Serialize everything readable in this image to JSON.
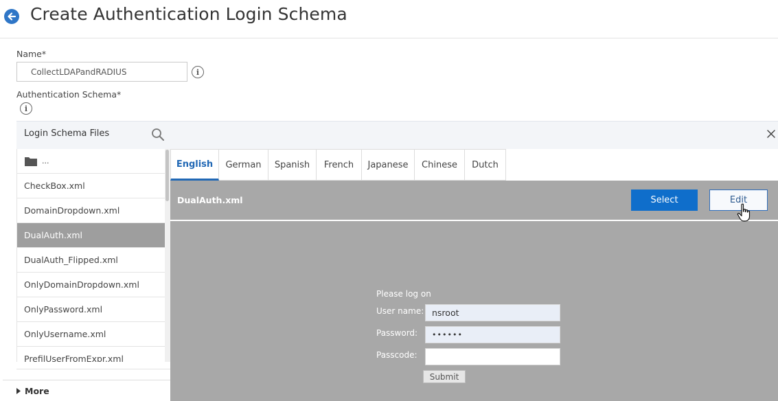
{
  "header": {
    "title": "Create Authentication Login Schema"
  },
  "form": {
    "name_label": "Name*",
    "name_value": "CollectLDAPandRADIUS",
    "schema_label": "Authentication Schema*"
  },
  "panel": {
    "title": "Login Schema Files",
    "files": [
      {
        "label": "..."
      },
      {
        "label": "CheckBox.xml"
      },
      {
        "label": "DomainDropdown.xml"
      },
      {
        "label": "DualAuth.xml"
      },
      {
        "label": "DualAuth_Flipped.xml"
      },
      {
        "label": "OnlyDomainDropdown.xml"
      },
      {
        "label": "OnlyPassword.xml"
      },
      {
        "label": "OnlyUsername.xml"
      },
      {
        "label": "PrefilUserFromExpr.xml"
      }
    ],
    "selected_file": "DualAuth.xml",
    "more_label": "More"
  },
  "tabs": [
    {
      "label": "English"
    },
    {
      "label": "German"
    },
    {
      "label": "Spanish"
    },
    {
      "label": "French"
    },
    {
      "label": "Japanese"
    },
    {
      "label": "Chinese"
    },
    {
      "label": "Dutch"
    }
  ],
  "active_tab": "English",
  "preview": {
    "file_name": "DualAuth.xml",
    "select_label": "Select",
    "edit_label": "Edit",
    "login": {
      "heading": "Please log on",
      "username_label": "User name:",
      "username_value": "nsroot",
      "password_label": "Password:",
      "password_value": "••••••",
      "passcode_label": "Passcode:",
      "passcode_value": "",
      "submit_label": "Submit"
    }
  },
  "colors": {
    "accent": "#0f6ecb",
    "selected_row": "#9e9e9e",
    "preview_bg": "#a8a8a8"
  }
}
